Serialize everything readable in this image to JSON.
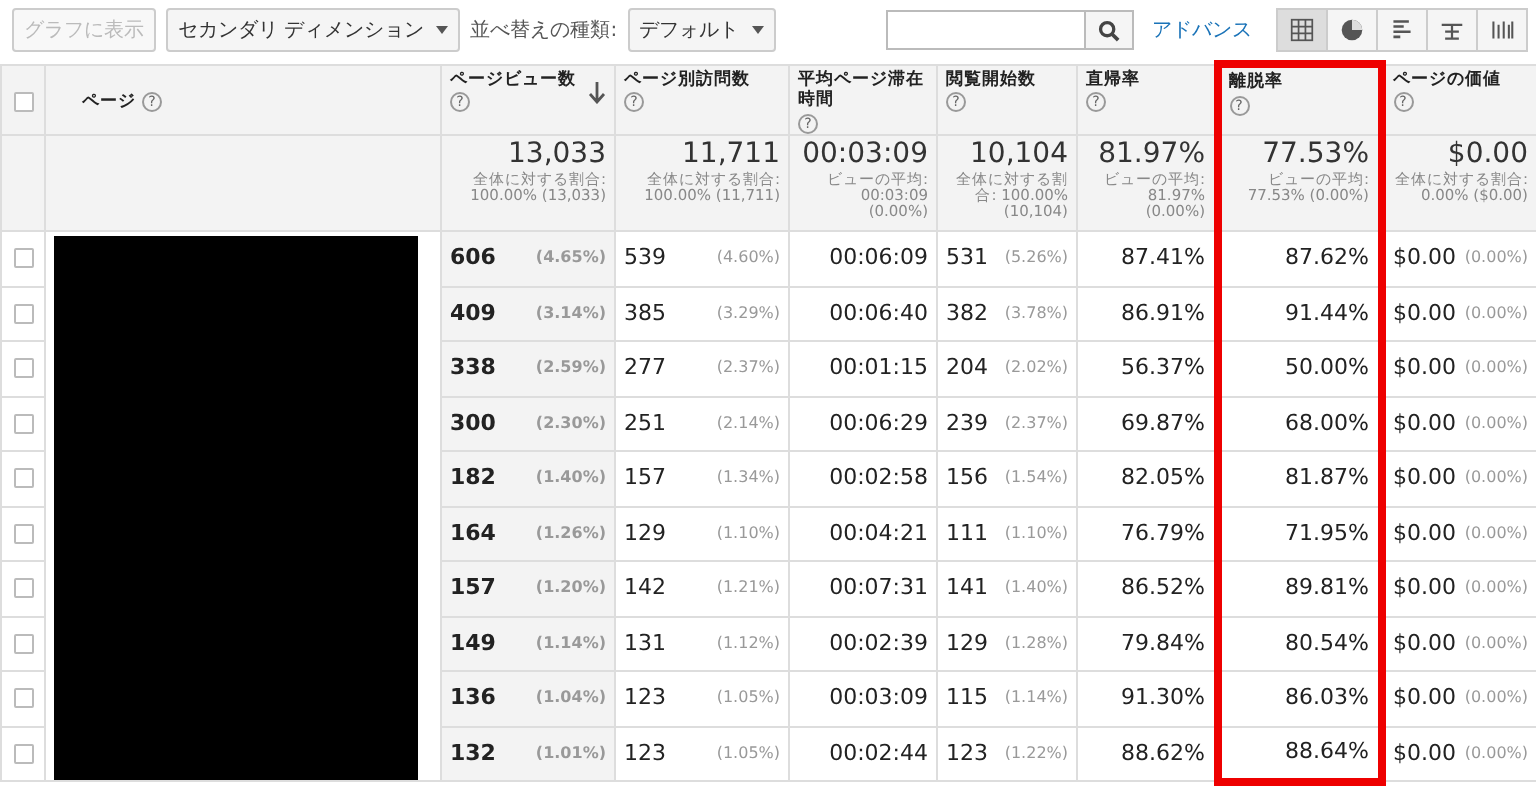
{
  "toolbar": {
    "chart_button": {
      "label": "グラフに表示",
      "disabled": true
    },
    "secondary_dimension": "セカンダリ ディメンション",
    "sort_label": "並べ替えの種類:",
    "sort_type": "デフォルト",
    "advanced_link": "アドバンス",
    "views": [
      {
        "kind": "table",
        "selected": true
      },
      {
        "kind": "pie",
        "selected": false
      },
      {
        "kind": "bars",
        "selected": false
      },
      {
        "kind": "compare",
        "selected": false
      },
      {
        "kind": "pivot",
        "selected": false
      }
    ]
  },
  "table": {
    "select_all": {
      "checked": false
    },
    "page_column": {
      "header": "ページ",
      "help": "?",
      "redacted": true
    },
    "columns": [
      {
        "header": "ページビュー数",
        "help": "?",
        "sorted": true,
        "highlighted": false,
        "total": "13,033",
        "total_note": "全体に対する割合: 100.00% (13,033)"
      },
      {
        "header": "ページ別訪問数",
        "help": "?",
        "sorted": false,
        "highlighted": false,
        "total": "11,711",
        "total_note": "全体に対する割合: 100.00% (11,711)"
      },
      {
        "header": "平均ページ滞在時間",
        "help": "?",
        "sorted": false,
        "highlighted": false,
        "total": "00:03:09",
        "total_note": "ビューの平均: 00:03:09 (0.00%)"
      },
      {
        "header": "閲覧開始数",
        "help": "?",
        "sorted": false,
        "highlighted": false,
        "total": "10,104",
        "total_note": "全体に対する割合: 100.00% (10,104)"
      },
      {
        "header": "直帰率",
        "help": "?",
        "sorted": false,
        "highlighted": false,
        "total": "81.97%",
        "total_note": "ビューの平均: 81.97% (0.00%)"
      },
      {
        "header": "離脱率",
        "help": "?",
        "sorted": false,
        "highlighted": true,
        "total": "77.53%",
        "total_note": "ビューの平均: 77.53% (0.00%)"
      },
      {
        "header": "ページの価値",
        "help": "?",
        "sorted": false,
        "highlighted": false,
        "total": "$0.00",
        "total_note": "全体に対する割合: 0.00% ($0.00)"
      }
    ],
    "rows": [
      {
        "checked": false,
        "cells": [
          {
            "value": "606",
            "share": "(4.65%)"
          },
          {
            "value": "539",
            "share": "(4.60%)"
          },
          {
            "value": "00:06:09"
          },
          {
            "value": "531",
            "share": "(5.26%)"
          },
          {
            "value": "87.41%"
          },
          {
            "value": "87.62%"
          },
          {
            "value": "$0.00",
            "share": "(0.00%)"
          }
        ]
      },
      {
        "checked": false,
        "cells": [
          {
            "value": "409",
            "share": "(3.14%)"
          },
          {
            "value": "385",
            "share": "(3.29%)"
          },
          {
            "value": "00:06:40"
          },
          {
            "value": "382",
            "share": "(3.78%)"
          },
          {
            "value": "86.91%"
          },
          {
            "value": "91.44%"
          },
          {
            "value": "$0.00",
            "share": "(0.00%)"
          }
        ]
      },
      {
        "checked": false,
        "cells": [
          {
            "value": "338",
            "share": "(2.59%)"
          },
          {
            "value": "277",
            "share": "(2.37%)"
          },
          {
            "value": "00:01:15"
          },
          {
            "value": "204",
            "share": "(2.02%)"
          },
          {
            "value": "56.37%"
          },
          {
            "value": "50.00%"
          },
          {
            "value": "$0.00",
            "share": "(0.00%)"
          }
        ]
      },
      {
        "checked": false,
        "cells": [
          {
            "value": "300",
            "share": "(2.30%)"
          },
          {
            "value": "251",
            "share": "(2.14%)"
          },
          {
            "value": "00:06:29"
          },
          {
            "value": "239",
            "share": "(2.37%)"
          },
          {
            "value": "69.87%"
          },
          {
            "value": "68.00%"
          },
          {
            "value": "$0.00",
            "share": "(0.00%)"
          }
        ]
      },
      {
        "checked": false,
        "cells": [
          {
            "value": "182",
            "share": "(1.40%)"
          },
          {
            "value": "157",
            "share": "(1.34%)"
          },
          {
            "value": "00:02:58"
          },
          {
            "value": "156",
            "share": "(1.54%)"
          },
          {
            "value": "82.05%"
          },
          {
            "value": "81.87%"
          },
          {
            "value": "$0.00",
            "share": "(0.00%)"
          }
        ]
      },
      {
        "checked": false,
        "cells": [
          {
            "value": "164",
            "share": "(1.26%)"
          },
          {
            "value": "129",
            "share": "(1.10%)"
          },
          {
            "value": "00:04:21"
          },
          {
            "value": "111",
            "share": "(1.10%)"
          },
          {
            "value": "76.79%"
          },
          {
            "value": "71.95%"
          },
          {
            "value": "$0.00",
            "share": "(0.00%)"
          }
        ]
      },
      {
        "checked": false,
        "cells": [
          {
            "value": "157",
            "share": "(1.20%)"
          },
          {
            "value": "142",
            "share": "(1.21%)"
          },
          {
            "value": "00:07:31"
          },
          {
            "value": "141",
            "share": "(1.40%)"
          },
          {
            "value": "86.52%"
          },
          {
            "value": "89.81%"
          },
          {
            "value": "$0.00",
            "share": "(0.00%)"
          }
        ]
      },
      {
        "checked": false,
        "cells": [
          {
            "value": "149",
            "share": "(1.14%)"
          },
          {
            "value": "131",
            "share": "(1.12%)"
          },
          {
            "value": "00:02:39"
          },
          {
            "value": "129",
            "share": "(1.28%)"
          },
          {
            "value": "79.84%"
          },
          {
            "value": "80.54%"
          },
          {
            "value": "$0.00",
            "share": "(0.00%)"
          }
        ]
      },
      {
        "checked": false,
        "cells": [
          {
            "value": "136",
            "share": "(1.04%)"
          },
          {
            "value": "123",
            "share": "(1.05%)"
          },
          {
            "value": "00:03:09"
          },
          {
            "value": "115",
            "share": "(1.14%)"
          },
          {
            "value": "91.30%"
          },
          {
            "value": "86.03%"
          },
          {
            "value": "$0.00",
            "share": "(0.00%)"
          }
        ]
      },
      {
        "checked": false,
        "cells": [
          {
            "value": "132",
            "share": "(1.01%)"
          },
          {
            "value": "123",
            "share": "(1.05%)"
          },
          {
            "value": "00:02:44"
          },
          {
            "value": "123",
            "share": "(1.22%)"
          },
          {
            "value": "88.62%"
          },
          {
            "value": "88.64%"
          },
          {
            "value": "$0.00",
            "share": "(0.00%)"
          }
        ]
      }
    ]
  }
}
